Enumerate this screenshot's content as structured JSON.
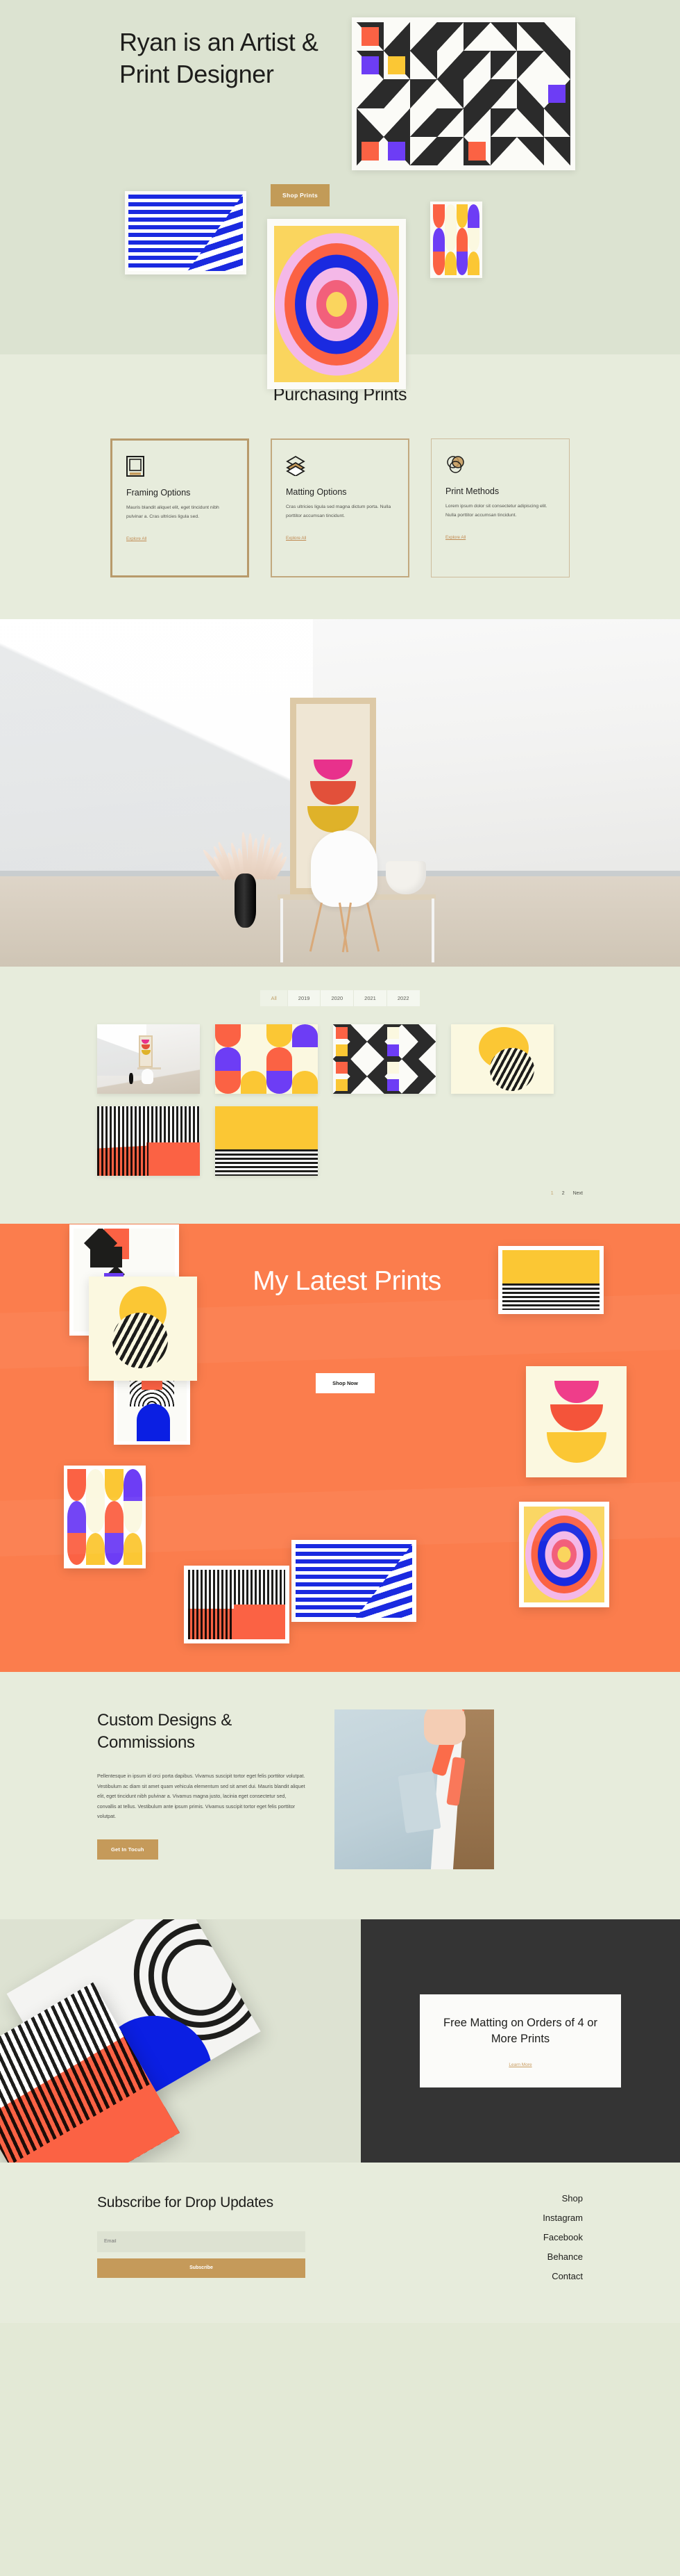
{
  "hero": {
    "title": "Ryan is an Artist & Print Designer",
    "cta_label": "Shop Prints",
    "artwork_geometric": "geometric-blocks-print",
    "artwork_stripes": "blue-op-art-stripes-print",
    "artwork_bullseye": "concentric-bullseye-print",
    "artwork_columns": "color-columns-print"
  },
  "purchasing": {
    "title": "Purchasing Prints",
    "cards": [
      {
        "icon": "frame-icon",
        "heading": "Framing Options",
        "body": "Mauris blandit aliquet elit, eget tincidunt nibh pulvinar a. Cras ultricies ligula sed.",
        "link": "Explore All"
      },
      {
        "icon": "layers-icon",
        "heading": "Matting Options",
        "body": "Cras ultricies ligula sed magna dictum porta. Nulla porttitor accumsan tincidunt.",
        "link": "Explore All"
      },
      {
        "icon": "overlapping-circles-icon",
        "heading": "Print Methods",
        "body": "Lorem ipsum dolor sit consectetur adipiscing elit. Nulla porttitor accumsan tincidunt.",
        "link": "Explore All"
      }
    ]
  },
  "interior": {
    "alt": "interior-room-with-framed-print-on-console-table"
  },
  "gallery": {
    "filters": [
      "All",
      "2019",
      "2020",
      "2021",
      "2022"
    ],
    "active_filter": "All",
    "thumbnails": [
      "interior-room-thumbnail",
      "arches-columns-print",
      "geometric-blocks-print",
      "yellow-sun-lines-print",
      "red-wavy-stripes-print",
      "yellow-wave-lines-print"
    ],
    "pagination": [
      "1",
      "2",
      "Next"
    ],
    "active_page": "1"
  },
  "latest": {
    "title": "My Latest Prints",
    "cta_label": "Shop Now",
    "prints": [
      "black-red-blocks-print",
      "yellow-sun-hatch-print",
      "blue-red-arch-print",
      "yellow-wave-lines-print",
      "pink-red-yellow-domes-print",
      "color-columns-print",
      "concentric-bullseye-print",
      "red-black-wavy-print",
      "blue-op-art-stripes-print"
    ]
  },
  "custom": {
    "title": "Custom Designs & Commissions",
    "body": "Pellentesque in ipsum id orci porta dapibus. Vivamus suscipit tortor eget felis porttitor volutpat. Vestibulum ac diam sit amet quam vehicula elementum sed sit amet dui. Mauris blandit aliquet elit, eget tincidunt nibh pulvinar a. Vivamus magna justo, lacinia eget consectetur sed, convallis at tellus. Vestibulum ante ipsum primis. Vivamus suscipit tortor eget felis porttitor volutpat.",
    "cta_label": "Get In Tocuh",
    "photo_alt": "hand-screen-printing-with-squeegee"
  },
  "promo": {
    "artwork_alt": "tilted-abstract-prints-stack",
    "heading": "Free Matting on Orders of 4 or More Prints",
    "link": "Learn More"
  },
  "footer": {
    "heading": "Subscribe for Drop Updates",
    "email_placeholder": "Email",
    "subscribe_label": "Subscribe",
    "links": [
      "Shop",
      "Instagram",
      "Facebook",
      "Behance",
      "Contact"
    ]
  },
  "colors": {
    "background": "#e7ecdc",
    "hero_background": "#dce3d1",
    "accent_gold": "#c59a5a",
    "accent_orange": "#fb7d4d",
    "dark": "#343434",
    "link_gold": "#c79b5e",
    "print_red": "#fb6244",
    "print_blue": "#6d3df5",
    "print_yellow": "#fbc734",
    "print_cream": "#fbf8e0",
    "print_black": "#2b2b2b",
    "deep_blue": "#1a2ae0",
    "pink": "#ef3d8a"
  }
}
